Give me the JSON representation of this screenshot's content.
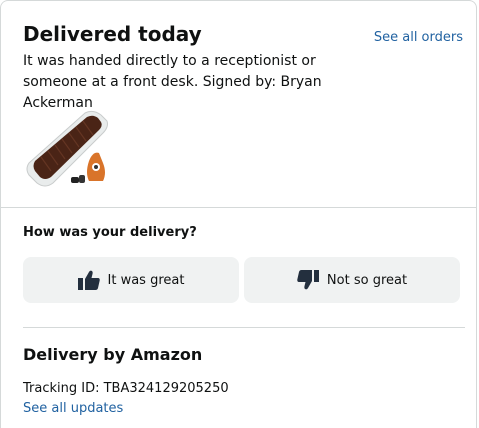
{
  "header": {
    "title": "Delivered today",
    "see_all_orders": "See all orders",
    "description": "It was handed directly to a receptionist or someone at a front desk. Signed by: Bryan Ackerman"
  },
  "product": {
    "image_icon": "air-mattress-with-pump-icon"
  },
  "feedback": {
    "question": "How was your delivery?",
    "great_label": "It was great",
    "great_icon": "thumbs-up-icon",
    "not_great_label": "Not so great",
    "not_great_icon": "thumbs-down-icon"
  },
  "delivery": {
    "heading": "Delivery by Amazon",
    "tracking": "Tracking ID: TBA324129205250",
    "see_updates": "See all updates"
  },
  "colors": {
    "link": "#2162a1",
    "button_bg": "#f0f2f2",
    "divider": "#d5d9d9"
  }
}
